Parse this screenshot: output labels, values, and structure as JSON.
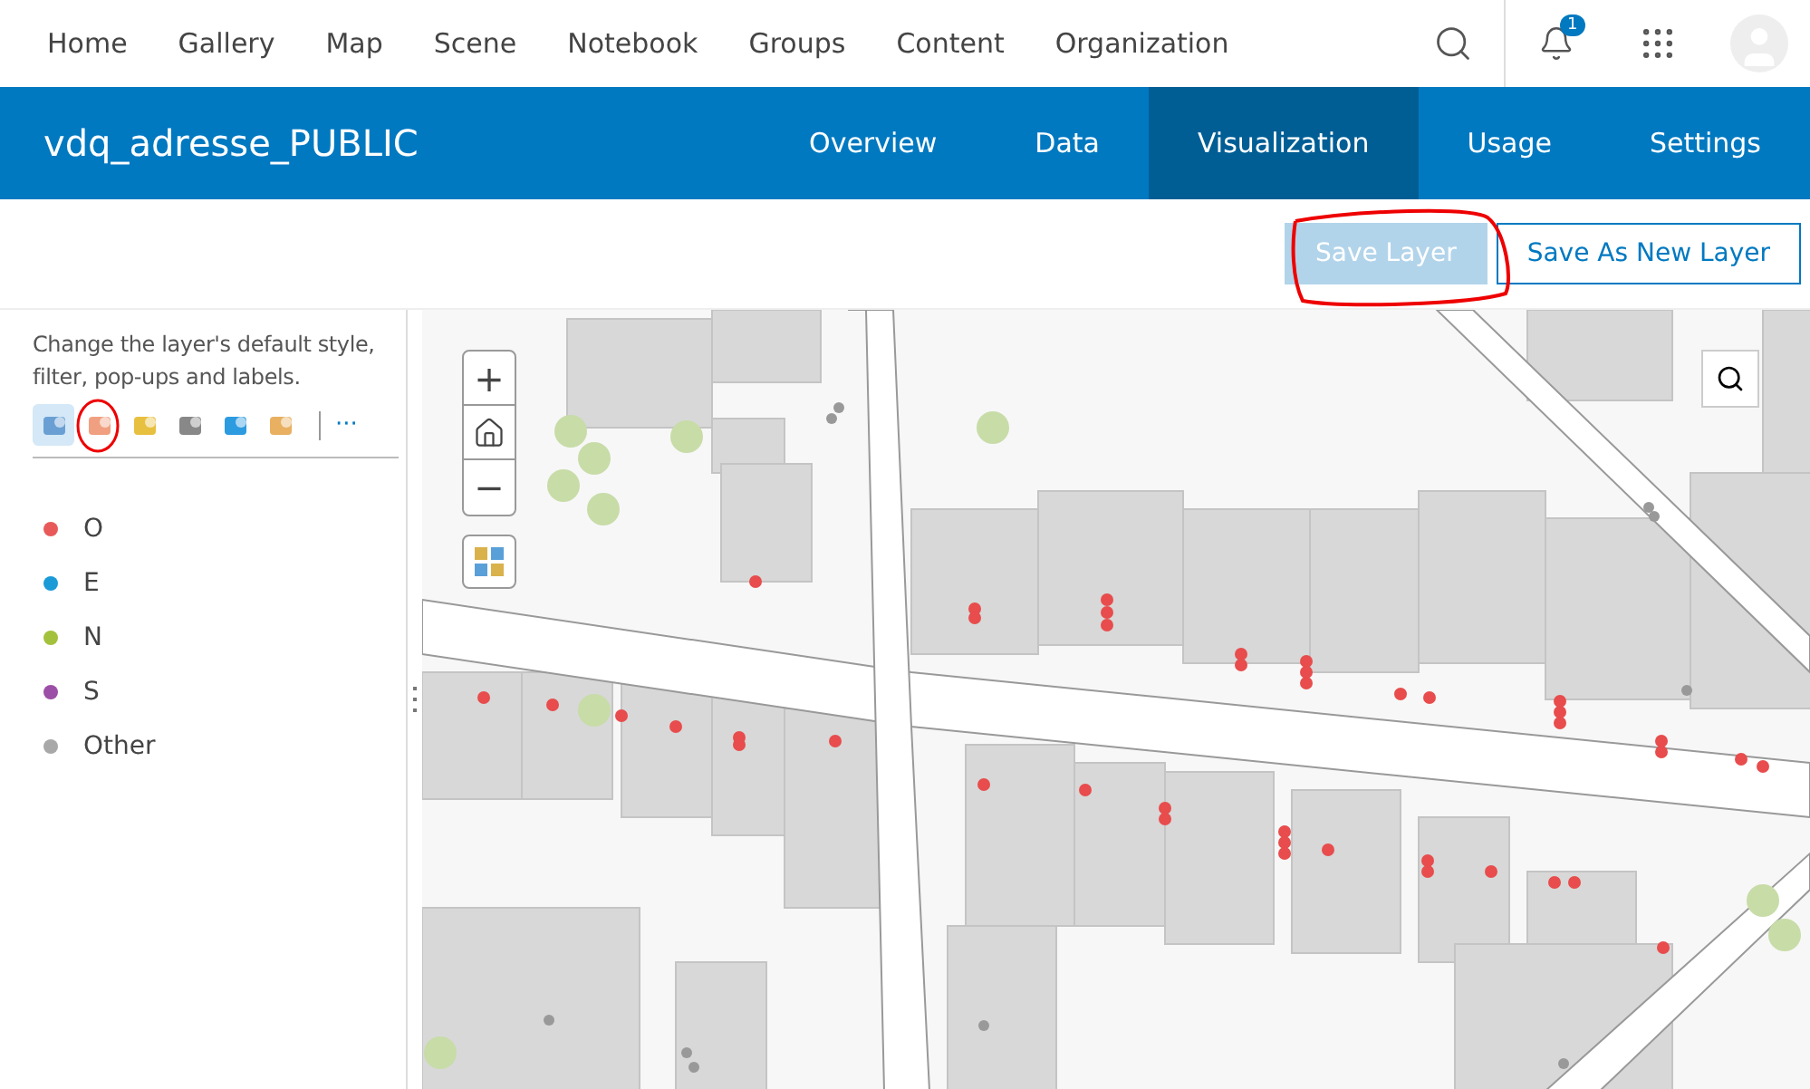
{
  "top_nav": {
    "items": [
      {
        "label": "Home",
        "selected": false
      },
      {
        "label": "Gallery",
        "selected": false
      },
      {
        "label": "Map",
        "selected": false
      },
      {
        "label": "Scene",
        "selected": false
      },
      {
        "label": "Notebook",
        "selected": false
      },
      {
        "label": "Groups",
        "selected": false
      },
      {
        "label": "Content",
        "selected": false
      },
      {
        "label": "Organization",
        "selected": false
      }
    ],
    "notification_count": "1"
  },
  "item_header": {
    "title": "vdq_adresse_PUBLIC",
    "tabs": [
      {
        "label": "Overview",
        "selected": false
      },
      {
        "label": "Data",
        "selected": false
      },
      {
        "label": "Visualization",
        "selected": true
      },
      {
        "label": "Usage",
        "selected": false
      },
      {
        "label": "Settings",
        "selected": false
      }
    ]
  },
  "actions": [
    {
      "label": "Save Layer",
      "kind": "primary",
      "disabled": true
    },
    {
      "label": "Save As New Layer",
      "kind": "outline",
      "disabled": false
    }
  ],
  "side_panel": {
    "description": "Change the layer's default style, filter, pop-ups and labels.",
    "tools": [
      {
        "selected": true
      },
      {
        "selected": false
      },
      {
        "selected": false
      },
      {
        "selected": false
      },
      {
        "selected": false
      },
      {
        "selected": false
      }
    ],
    "more": "···",
    "legend": [
      {
        "label": "O",
        "color": "#e85a5a"
      },
      {
        "label": "E",
        "color": "#1a9bd7"
      },
      {
        "label": "N",
        "color": "#a3c13c"
      },
      {
        "label": "S",
        "color": "#9c4fa6"
      },
      {
        "label": "Other",
        "color": "#a8a8a8"
      }
    ]
  },
  "map": {
    "zoom_in": "+",
    "zoom_out": "−"
  }
}
